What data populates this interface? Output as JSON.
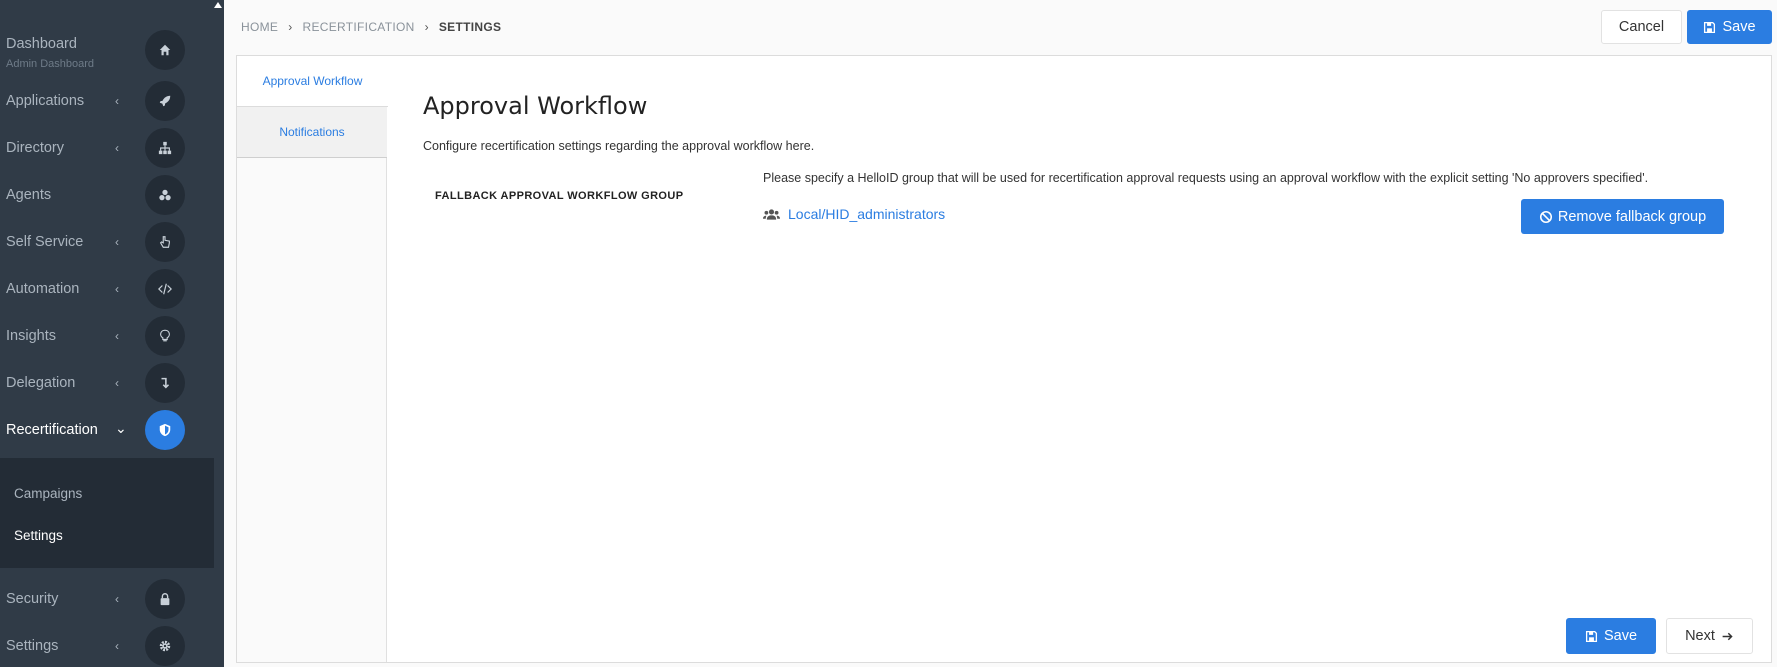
{
  "sidebar": {
    "items": [
      {
        "label": "Dashboard",
        "sub": "Admin Dashboard",
        "icon": "home-icon"
      },
      {
        "label": "Applications",
        "icon": "rocket-icon"
      },
      {
        "label": "Directory",
        "icon": "sitemap-icon"
      },
      {
        "label": "Agents",
        "icon": "cubes-icon"
      },
      {
        "label": "Self Service",
        "icon": "hand-pointer-icon"
      },
      {
        "label": "Automation",
        "icon": "code-icon"
      },
      {
        "label": "Insights",
        "icon": "lightbulb-icon"
      },
      {
        "label": "Delegation",
        "icon": "level-down-icon"
      },
      {
        "label": "Recertification",
        "icon": "shield-icon"
      },
      {
        "label": "Security",
        "icon": "lock-icon"
      },
      {
        "label": "Settings",
        "icon": "gear-icon"
      }
    ],
    "submenu": [
      "Campaigns",
      "Settings"
    ]
  },
  "breadcrumb": [
    "HOME",
    "RECERTIFICATION",
    "SETTINGS"
  ],
  "header": {
    "cancel_label": "Cancel",
    "save_label": "Save"
  },
  "tabs": [
    "Approval Workflow",
    "Notifications"
  ],
  "content": {
    "title": "Approval Workflow",
    "description": "Configure recertification settings regarding the approval workflow here.",
    "field_label": "FALLBACK APPROVAL WORKFLOW GROUP",
    "field_help": "Please specify a HelloID group that will be used for recertification approval requests using an approval workflow with the explicit setting 'No approvers specified'.",
    "group_name": "Local/HID_administrators",
    "remove_label": "Remove fallback group"
  },
  "footer": {
    "save_label": "Save",
    "next_label": "Next"
  },
  "colors": {
    "accent": "#2b7de1",
    "sidebar": "#303b47"
  }
}
